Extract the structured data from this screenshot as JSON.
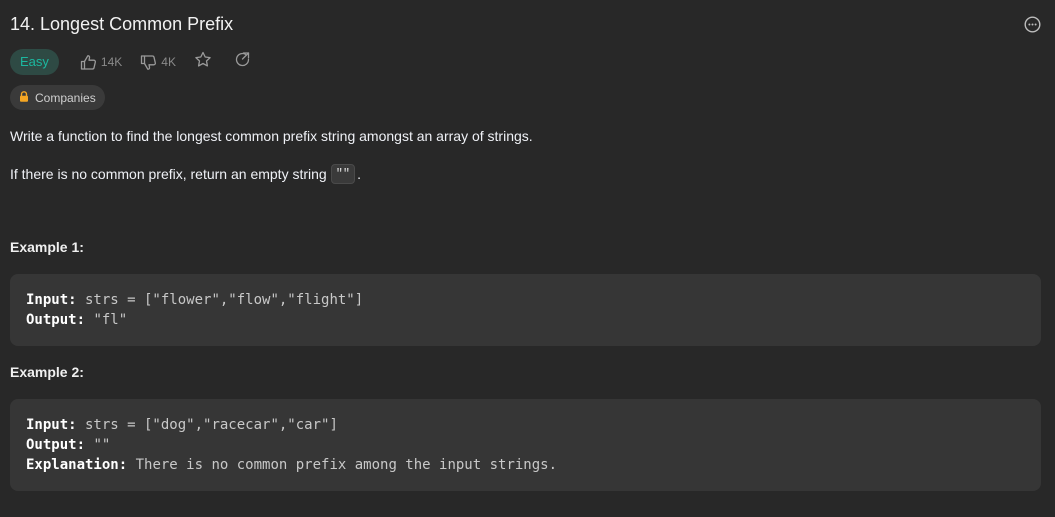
{
  "problem": {
    "title": "14. Longest Common Prefix",
    "difficulty": "Easy",
    "likes": "14K",
    "dislikes": "4K",
    "companies_label": "Companies"
  },
  "description": {
    "line1": "Write a function to find the longest common prefix string amongst an array of strings.",
    "line2_before": "If there is no common prefix, return an empty string",
    "line2_code": "\"\"",
    "line2_after": "."
  },
  "examples": [
    {
      "heading": "Example 1:",
      "input_label": "Input:",
      "input_value": " strs = [\"flower\",\"flow\",\"flight\"]",
      "output_label": "Output:",
      "output_value": " \"fl\""
    },
    {
      "heading": "Example 2:",
      "input_label": "Input:",
      "input_value": " strs = [\"dog\",\"racecar\",\"car\"]",
      "output_label": "Output:",
      "output_value": " \"\"",
      "explanation_label": "Explanation:",
      "explanation_value": " There is no common prefix among the input strings."
    }
  ],
  "colors": {
    "background": "#282828",
    "easy_text": "#1cb8a0",
    "easy_bg": "#2e4a44",
    "lock": "#f5a623"
  },
  "icons": {
    "more": "ellipsis-circle-icon",
    "like": "thumbs-up-icon",
    "dislike": "thumbs-down-icon",
    "favorite": "star-icon",
    "share": "share-icon",
    "lock": "lock-icon"
  }
}
